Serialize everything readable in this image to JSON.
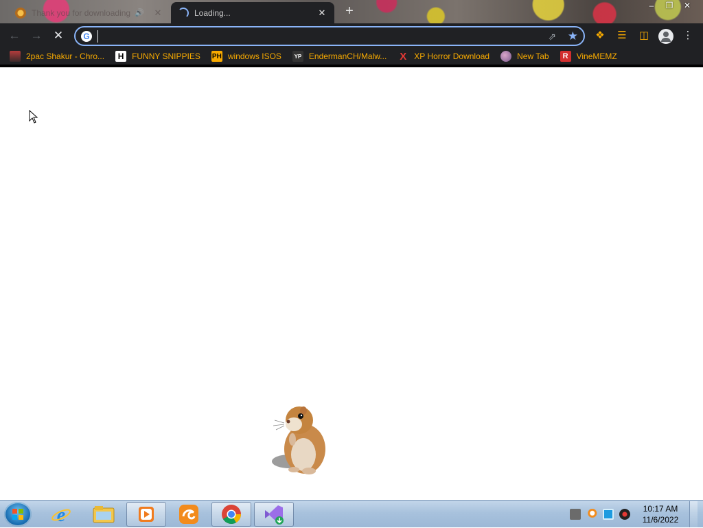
{
  "tabs": [
    {
      "title": "Thank you for downloading",
      "state": "inactive",
      "audio": true
    },
    {
      "title": "Loading...",
      "state": "active"
    }
  ],
  "omnibox": {
    "value": "",
    "placeholder": ""
  },
  "bookmarks": [
    {
      "label": "2pac Shakur - Chro...",
      "icon": "person-photo-icon"
    },
    {
      "label": "FUNNY SNIPPIES",
      "icon": "H",
      "icon_color": "#000000",
      "icon_bg": "#ffffff"
    },
    {
      "label": "windows ISOS",
      "icon": "PH",
      "icon_color": "#000000",
      "icon_bg": "#f9ab00"
    },
    {
      "label": "EndermanCH/Malw...",
      "icon": "YP",
      "icon_color": "#ffffff",
      "icon_bg": "#333333"
    },
    {
      "label": "XP Horror Download",
      "icon": "X",
      "icon_color": "#e53935",
      "icon_bg": "transparent"
    },
    {
      "label": "New Tab",
      "icon": "globe-icon"
    },
    {
      "label": "VineMEMZ",
      "icon": "R",
      "icon_color": "#ffffff",
      "icon_bg": "#d32f2f"
    }
  ],
  "taskbar": {
    "apps": [
      "internet-explorer-icon",
      "file-explorer-icon",
      "media-player-icon",
      "uc-browser-icon",
      "chrome-icon",
      "visual-studio-installer-icon"
    ]
  },
  "clock": {
    "time": "10:17 AM",
    "date": "11/6/2022"
  },
  "colors": {
    "bookmark_text": "#f9ab00",
    "toolbar_bg": "#202124",
    "focus_ring": "#8ab4f8"
  }
}
